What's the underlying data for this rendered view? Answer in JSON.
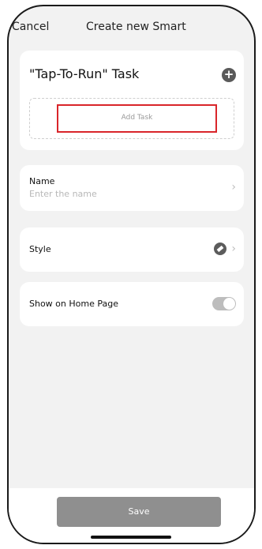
{
  "header": {
    "cancel_label": "Cancel",
    "title": "Create new Smart"
  },
  "task_card": {
    "title": "\"Tap-To-Run\" Task",
    "add_task_label": "Add Task"
  },
  "name_row": {
    "label": "Name",
    "placeholder": "Enter the name"
  },
  "style_row": {
    "label": "Style"
  },
  "home_row": {
    "label": "Show on Home Page",
    "toggle_on": false
  },
  "footer": {
    "save_label": "Save"
  },
  "colors": {
    "highlight": "#d9252a",
    "save_button": "#8f8f8f",
    "background": "#f2f2f2"
  },
  "icons": {
    "add": "plus-circle-icon",
    "style": "palette-icon",
    "chevron": "chevron-right-icon"
  }
}
